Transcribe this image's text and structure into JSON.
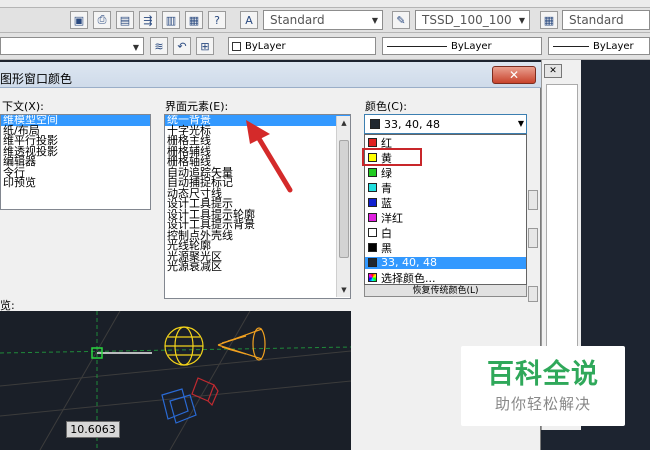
{
  "toolbar": {
    "text_style": "Standard",
    "dim_style": "TSSD_100_100",
    "table_style": "Standard",
    "color_control": "ByLayer",
    "linetype_control": "ByLayer",
    "lineweight_control": "ByLayer"
  },
  "dialog": {
    "title": "图形窗口颜色",
    "close_label": "✕",
    "context_label": "下文(X):",
    "context_items": [
      "维模型空间",
      "纸/布局",
      "维平行投影",
      "维透视投影",
      "编辑器",
      "令行",
      "印预览"
    ],
    "element_label": "界面元素(E):",
    "element_items": [
      "统一背景",
      "十字光标",
      "栅格主线",
      "栅格辅线",
      "栅格轴线",
      "自动追踪矢量",
      "自动捕捉标记",
      "动态尺寸线",
      "设计工具提示",
      "设计工具提示轮廓",
      "设计工具提示背景",
      "控制点外壳线",
      "光线轮廓",
      "光源聚光区",
      "光源衰减区"
    ],
    "color_label": "颜色(C):",
    "color_current": "33, 40, 48",
    "color_options": [
      {
        "label": "红",
        "swatch": "#e02020"
      },
      {
        "label": "黄",
        "swatch": "#ffff00"
      },
      {
        "label": "绿",
        "swatch": "#22cc22"
      },
      {
        "label": "青",
        "swatch": "#22e0e0"
      },
      {
        "label": "蓝",
        "swatch": "#1020d0"
      },
      {
        "label": "洋红",
        "swatch": "#e020e0"
      },
      {
        "label": "白",
        "swatch": "#ffffff"
      },
      {
        "label": "黑",
        "swatch": "#000000"
      },
      {
        "label": "33, 40, 48",
        "swatch": "#212830"
      },
      {
        "label": "选择颜色...",
        "swatch": "multicolor"
      }
    ],
    "restore_label": "恢复传统颜色(L)",
    "preview_label": "览:",
    "measure_value": "10.6063"
  },
  "watermark": {
    "title": "百科全说",
    "subtitle": "助你轻松解决"
  },
  "colors": {
    "selection": "#3399ff",
    "highlight_box": "#c8262a",
    "annotation_arrow": "#d42a2a",
    "preview_bg": "#1a1f28",
    "brand_green": "#2fa85a"
  }
}
